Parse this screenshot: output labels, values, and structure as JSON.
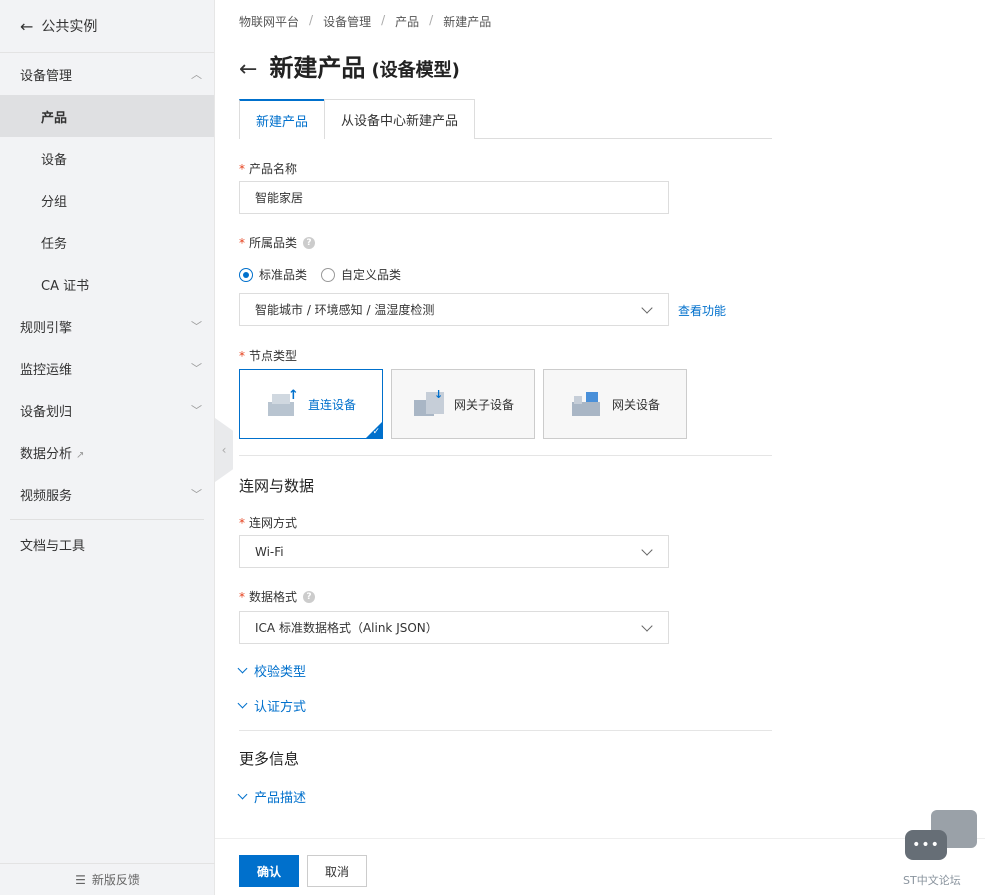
{
  "sidebar": {
    "back_label": "公共实例",
    "group_device_mgmt": "设备管理",
    "sub_items": [
      "产品",
      "设备",
      "分组",
      "任务",
      "CA 证书"
    ],
    "groups": [
      "规则引擎",
      "监控运维",
      "设备划归"
    ],
    "data_analysis": "数据分析",
    "video_service": "视频服务",
    "docs_tools": "文档与工具",
    "feedback": "新版反馈"
  },
  "breadcrumb": [
    "物联网平台",
    "设备管理",
    "产品",
    "新建产品"
  ],
  "page": {
    "title": "新建产品",
    "subtitle": "(设备模型)"
  },
  "tabs": [
    "新建产品",
    "从设备中心新建产品"
  ],
  "form": {
    "product_name_label": "产品名称",
    "product_name_value": "智能家居",
    "category_label": "所属品类",
    "radio_standard": "标准品类",
    "radio_custom": "自定义品类",
    "category_value": "智能城市 / 环境感知 / 温湿度检测",
    "view_function": "查看功能",
    "node_type_label": "节点类型",
    "node_types": [
      "直连设备",
      "网关子设备",
      "网关设备"
    ],
    "section_network": "连网与数据",
    "network_label": "连网方式",
    "network_value": "Wi-Fi",
    "data_format_label": "数据格式",
    "data_format_value": "ICA 标准数据格式（Alink JSON）",
    "verify_type": "校验类型",
    "auth_method": "认证方式",
    "section_more": "更多信息",
    "product_desc": "产品描述"
  },
  "buttons": {
    "confirm": "确认",
    "cancel": "取消"
  },
  "watermark": {
    "bubble": "•••",
    "text": "ST中文论坛"
  },
  "colors": {
    "accent": "#0070cc",
    "required": "#e5421e"
  }
}
